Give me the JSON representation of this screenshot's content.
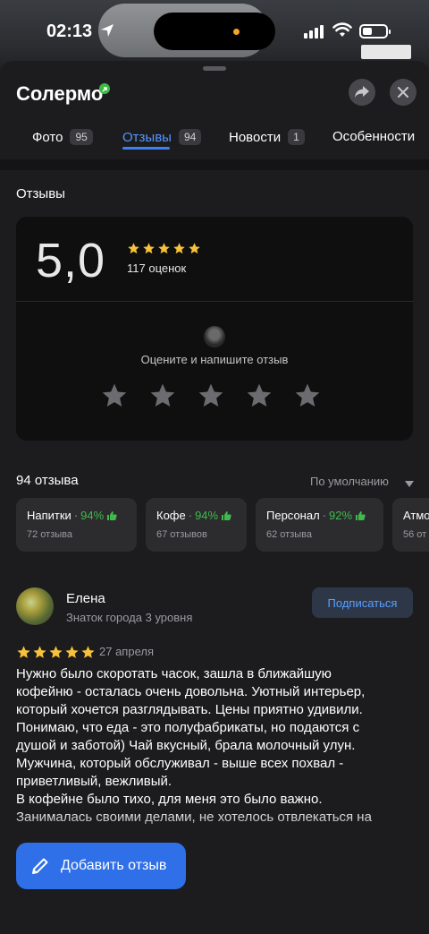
{
  "status_bar": {
    "time": "02:13"
  },
  "place": {
    "name": "Солермо"
  },
  "tabs": [
    {
      "label": "Фото",
      "count": "95"
    },
    {
      "label": "Отзывы",
      "count": "94"
    },
    {
      "label": "Новости",
      "count": "1"
    },
    {
      "label": "Особенности"
    }
  ],
  "reviews_section": {
    "title": "Отзывы",
    "rating": "5,0",
    "ratings_count": "117 оценок",
    "prompt": "Оцените и напишите отзыв"
  },
  "reviews_list": {
    "count_label": "94 отзыва",
    "sort_label": "По умолчанию"
  },
  "aspects": [
    {
      "name": "Напитки",
      "percent": "94%",
      "reviews": "72 отзыва"
    },
    {
      "name": "Кофе",
      "percent": "94%",
      "reviews": "67 отзывов"
    },
    {
      "name": "Персонал",
      "percent": "92%",
      "reviews": "62 отзыва"
    },
    {
      "name": "Атмо",
      "percent": "",
      "reviews": "56 от"
    }
  ],
  "review": {
    "author": "Елена",
    "level": "Знаток города 3 уровня",
    "subscribe_label": "Подписаться",
    "stars": 5,
    "date": "27 апреля",
    "text": "Нужно было скоротать часок, зашла в ближайшую\nкофейню - осталась очень довольна. Уютный интерьер,\nкоторый хочется разглядывать. Цены приятно удивили.\nПонимаю, что еда - это полуфабрикаты, но подаются с\nдушой и заботой) Чай вкусный, брала молочный улун.\nМужчина, который обслуживал - выше всех похвал -\nприветливый, вежливый.\nВ кофейне было тихо, для меня это было важно.\nЗанималась своими делами, не хотелось отвлекаться на"
  },
  "add_review": {
    "label": "Добавить отзыв"
  },
  "colors": {
    "accent": "#3d7ff5",
    "star": "#f7c23a",
    "positive": "#3fba4d"
  },
  "icons": [
    "location-arrow-icon",
    "signal-icon",
    "wifi-icon",
    "battery-icon",
    "share-icon",
    "close-icon",
    "star-icon",
    "thumbs-up-icon",
    "chevron-down-icon",
    "pencil-icon"
  ]
}
